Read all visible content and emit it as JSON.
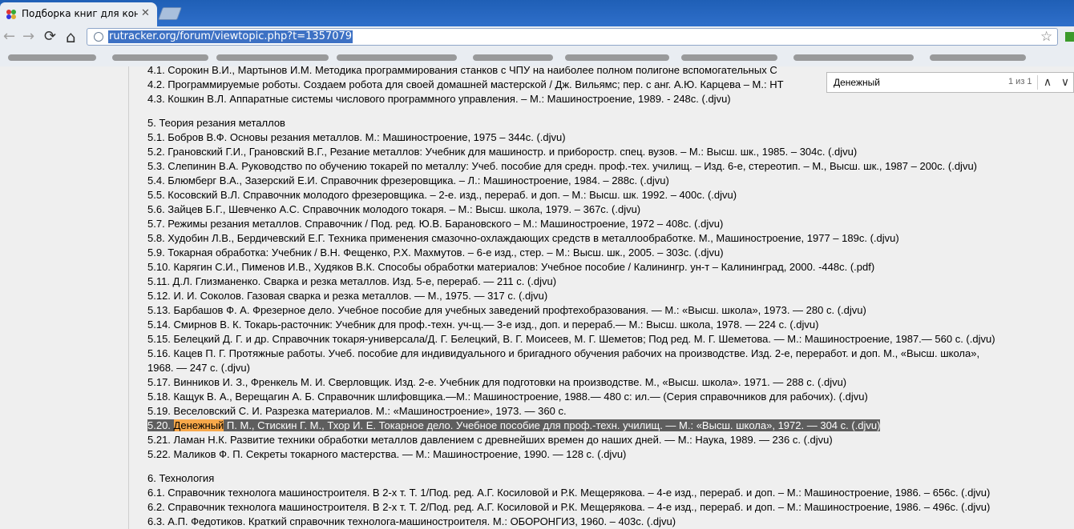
{
  "browser": {
    "tab_title": "Подборка книг для констр",
    "tab_close": "✕",
    "nav_back": "←",
    "nav_forward": "→",
    "nav_reload": "⟳",
    "nav_home": "⌂",
    "url": "rutracker.org/forum/viewtopic.php?t=1357079",
    "star": "☆",
    "icons": [
      "favicon-icon",
      "close-icon",
      "new-tab-icon",
      "back-icon",
      "forward-icon",
      "reload-icon",
      "home-icon",
      "globe-icon",
      "star-icon",
      "extension-icon"
    ]
  },
  "find": {
    "query": "Денежный",
    "count": "1 из 1",
    "prev": "∧",
    "next": "∨"
  },
  "colors": {
    "tabstrip": "#2f6fca",
    "chrome": "#e9edf2",
    "url_selection": "#3d71c4",
    "line_highlight": "#5e5e5e",
    "find_highlight": "#f7a84a",
    "page_bg": "#efefef"
  },
  "post": {
    "lines": [
      "4.1. Сорокин В.И., Мартынов И.М. Методика программирования станков с ЧПУ на наиболее полном полигоне вспомогательных С",
      "4.2. Программируемые роботы. Создаем робота для своей домашней мастерской / Дж. Вильямс; пер. с анг. А.Ю. Карцева – М.: НТ",
      "4.3. Кошкин В.Л. Аппаратные системы числового программного управления. – М.: Машиностроение, 1989. - 248с. (.djvu)",
      "5. Теория резания металлов",
      "5.1. Бобров В.Ф. Основы резания металлов. М.: Машиностроение, 1975 – 344с. (.djvu)",
      "5.2. Грановский Г.И., Грановский В.Г., Резание металлов: Учебник для машиностр. и приборостр. спец. вузов. – М.: Высш. шк., 1985. – 304с. (.djvu)",
      "5.3. Слепинин В.А. Руководство по обучению токарей по металлу: Учеб. пособие для средн. проф.-тех. училищ. – Изд. 6-е, стереотип. – М., Высш. шк., 1987 – 200с. (.djvu)",
      "5.4. Блюмберг В.А., Зазерский Е.И. Справочник фрезеровщика. – Л.: Машиностроение, 1984. – 288с. (.djvu)",
      "5.5. Косовский В.Л. Справочник молодого фрезеровщика. – 2-е. изд., перераб. и доп. – М.: Высш. шк. 1992. – 400с. (.djvu)",
      "5.6. Зайцев Б.Г., Шевченко А.С. Справочник молодого токаря. – М.: Высш. школа, 1979. – 367с. (.djvu)",
      "5.7. Режимы резания металлов. Справочник / Под. ред. Ю.В. Барановского – М.: Машиностроение, 1972 – 408с. (.djvu)",
      "5.8. Худобин Л.В., Бердичевский Е.Г. Техника применения смазочно-охлаждающих средств в металлообработке. М., Машиностроение, 1977 – 189с. (.djvu)",
      "5.9. Токарная обработка: Учебник / В.Н. Фещенко, Р.Х. Махмутов. – 6-е изд., стер. – М.: Высш. шк., 2005. – 303с. (.djvu)",
      "5.10. Карягин С.И., Пименов И.В., Худяков В.К. Способы обработки материалов: Учебное пособие / Калинингр. ун-т – Калининград, 2000. -448с. (.pdf)",
      "5.11. Д.Л. Глизманенко. Сварка и резка металлов. Изд. 5-е, перераб. — 211 с. (.djvu)",
      "5.12. И. И. Соколов. Газовая сварка и резка металлов. — М., 1975. — 317 с. (.djvu)",
      "5.13. Барбашов Ф. А. Фрезерное дело. Учебное пособие для учебных заведений профтехобразования. — М.: «Высш. школа», 1973. — 280 с. (.djvu)",
      "5.14. Смирнов В. К. Токарь-расточник: Учебник для проф.-техн. уч-щ.— 3-е изд., доп. и перераб.— М.: Высш. школа, 1978. — 224 с. (.djvu)",
      "5.15. Белецкий Д. Г. и др. Справочник токаря-универсала/Д. Г. Белецкий, В. Г. Моисеев, М. Г. Шеметов; Под ред. М. Г. Шеметова. — М.: Машиностроение, 1987.— 560 с. (.djvu)",
      "5.16. Кацев П. Г. Протяжные работы. Учеб. пособие для индивидуального и бригадного обучения рабочих на производстве. Изд. 2-е, переработ. и доп. М., «Высш. школа»,",
      "1968. — 247 с. (.djvu)",
      "5.17. Винников И. З., Френкель М. И. Сверловщик. Изд. 2-е. Учебник для подготовки на производстве. М., «Высш. школа». 1971. — 288 с. (.djvu)",
      "5.18. Кащук В. А., Верещагин А. Б. Справочник шлифовщика.—М.: Машиностроение, 1988.— 480 с: ил.— (Серия справочников для рабочих). (.djvu)",
      "5.19. Веселовский С. И. Разрезка материалов. М.: «Машиностроение», 1973. — 360 с.",
      "5.21. Ламан Н.К. Развитие техники обработки металлов давлением с древнейших времен до наших дней. — М.: Наука, 1989. — 236 с. (.djvu)",
      "5.22. Маликов Ф. П. Секреты токарного мастерства. — М.: Машиностроение, 1990. — 128 с. (.djvu)",
      "6. Технология",
      "6.1. Справочник технолога машиностроителя. В 2-х т. Т. 1/Под. ред. А.Г. Косиловой и Р.К. Мещерякова. – 4-е изд., перераб. и доп. – М.: Машиностроение, 1986. – 656с. (.djvu)",
      "6.2. Справочник технолога машиностроителя. В 2-х т. Т. 2/Под. ред. А.Г. Косиловой и Р.К. Мещерякова. – 4-е изд., перераб. и доп. – М.: Машиностроение, 1986. – 496с. (.djvu)",
      "6.3. А.П. Федотиков. Краткий справочник технолога-машиностроителя. М.: ОБОРОНГИЗ, 1960. – 403с. (.djvu)"
    ],
    "highlight_line": {
      "prefix": "5.20. ",
      "match": "Денежный",
      "rest": " П. М., Стискин Г. М., Тхор И. Е. Токарное дело. Учебное пособие для проф.-техн. училищ. — М.: «Высш. школа», 1972. — 304 с. (.djvu)"
    }
  }
}
